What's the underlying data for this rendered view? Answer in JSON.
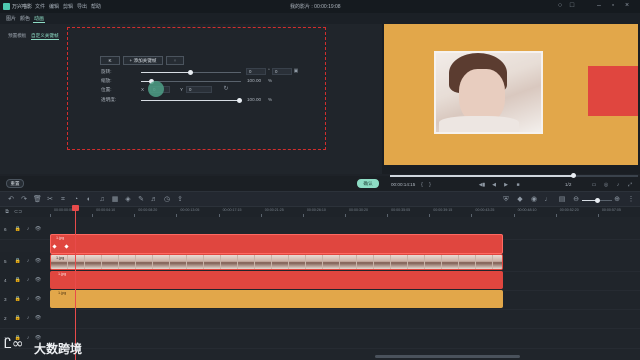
{
  "titlebar": {
    "app_name": "万兴喵影",
    "menus": [
      "文件",
      "编辑",
      "剪辑",
      "导出",
      "帮助"
    ],
    "project_title": "我的影片 : 00:00:19:08"
  },
  "tabs": [
    "图片",
    "颜色",
    "动画"
  ],
  "anim_subtabs": [
    "预置模板",
    "自定义关键帧"
  ],
  "keyframe": {
    "nav_label": "K",
    "add_label": "+ 添加关键帧",
    "rows": [
      {
        "label": "旋转:",
        "value": "0",
        "unit": "°",
        "extra": "0"
      },
      {
        "label": "缩放:",
        "value": "100.00",
        "unit": "%"
      },
      {
        "label": "位置:",
        "x_label": "X",
        "x": "0",
        "y_label": "Y",
        "y": "0"
      },
      {
        "label": "透明度:",
        "value": "100.00",
        "unit": "%"
      }
    ]
  },
  "buttons": {
    "reset": "重置",
    "ok": "确认"
  },
  "player": {
    "timecode": "00:00:14:15",
    "scale": "1/2",
    "playhead_fraction": 0.74
  },
  "ruler": {
    "ticks": [
      "00:00:00:00",
      "00:00:04:10",
      "00:00:08:20",
      "00:00:13:05",
      "00:00:17:15",
      "00:00:21:25",
      "00:00:26:10",
      "00:00:30:20",
      "00:00:35:05",
      "00:00:39:15",
      "00:00:43:25",
      "00:00:48:10",
      "00:00:52:20",
      "00:00:57:05"
    ]
  },
  "tracks": {
    "labels": [
      "6",
      "5",
      "4",
      "3",
      "2",
      "1"
    ],
    "clips": [
      "1.jpg",
      "1.jpg",
      "1.jpg",
      "1.jpg"
    ]
  },
  "watermark": "大数跨境",
  "colors": {
    "accent": "#8ddcc4",
    "red_clip": "#e0463f",
    "gold_clip": "#e2a74a",
    "playhead": "#e84b4b"
  }
}
